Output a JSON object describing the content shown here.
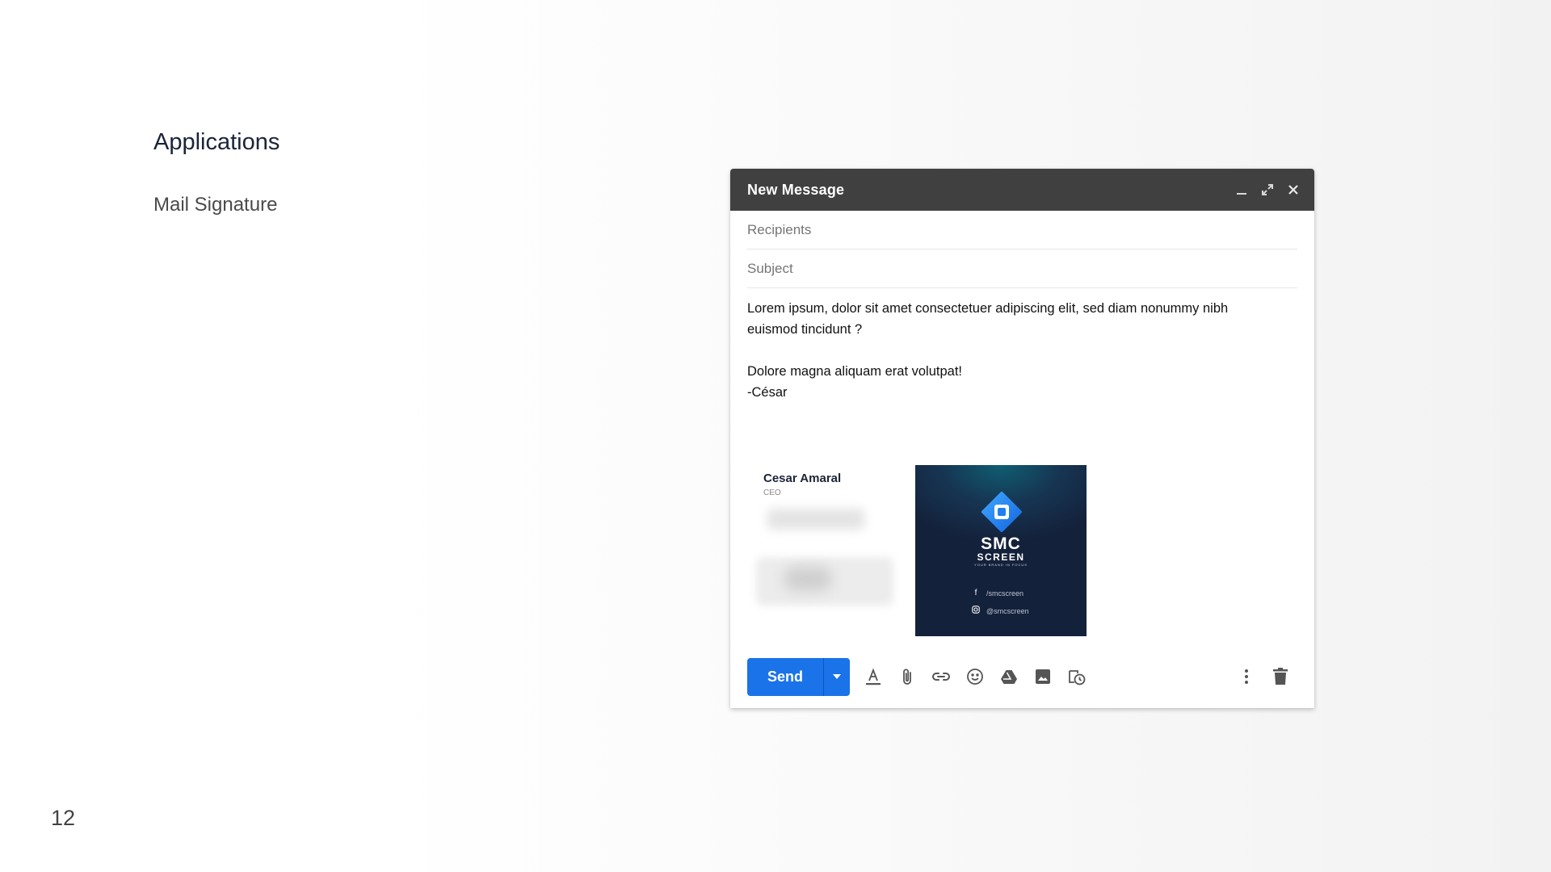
{
  "slide": {
    "heading": "Applications",
    "subheading": "Mail Signature",
    "page_number": "12"
  },
  "compose": {
    "title": "New Message",
    "recipients_placeholder": "Recipients",
    "subject_placeholder": "Subject",
    "body": {
      "line1": "Lorem ipsum, dolor sit amet consectetuer adipiscing elit, sed diam nonummy nibh",
      "line2": "euismod tincidunt ?",
      "line3": "Dolore magna aliquam erat volutpat!",
      "line4": "-César"
    },
    "send_label": "Send"
  },
  "signature": {
    "name": "Cesar Amaral",
    "role": "CEO",
    "brand_line1": "SMC",
    "brand_line2": "SCREEN",
    "tagline": "YOUR BRAND IN FOCUS",
    "facebook": "/smcscreen",
    "instagram": "@smcscreen"
  },
  "colors": {
    "titlebar": "#404040",
    "send_button": "#1a73e8",
    "card_background": "#14213b",
    "logo_accent": "#1e90ff"
  },
  "icons": {
    "window": [
      "minimize-icon",
      "expand-icon",
      "close-icon"
    ],
    "toolbar": [
      "text-format-icon",
      "attach-icon",
      "link-icon",
      "emoji-icon",
      "drive-icon",
      "image-icon",
      "schedule-icon",
      "more-options-icon",
      "trash-icon"
    ]
  }
}
